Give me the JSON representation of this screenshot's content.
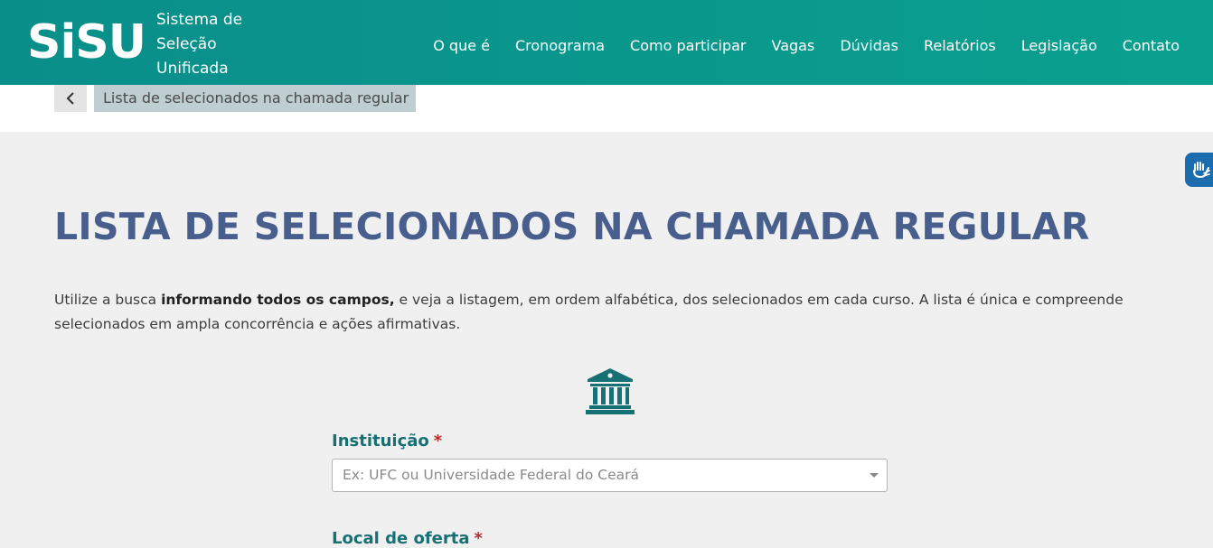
{
  "header": {
    "logo": "SiSU",
    "logo_sub": [
      "Sistema de",
      "Seleção",
      "Unificada"
    ],
    "nav": [
      "O que é",
      "Cronograma",
      "Como participar",
      "Vagas",
      "Dúvidas",
      "Relatórios",
      "Legislação",
      "Contato"
    ]
  },
  "breadcrumb": {
    "current": "Lista de selecionados na chamada regular"
  },
  "main": {
    "title": "LISTA DE SELECIONADOS NA CHAMADA REGULAR",
    "intro_before": "Utilize a busca ",
    "intro_bold": "informando todos os campos,",
    "intro_after": " e veja a listagem, em ordem alfabética, dos selecionados em cada curso. A lista é única e compreende selecionados em ampla concorrência e ações afirmativas.",
    "instituicao_label": "Instituição",
    "instituicao_placeholder": "Ex: UFC ou Universidade Federal do Ceará",
    "local_label": "Local de oferta",
    "required_mark": "*"
  },
  "icons": {
    "back": "chevron-left-icon",
    "institution": "bank-building-icon",
    "accessibility": "sign-language-icon"
  },
  "colors": {
    "header": "#0a8e8a",
    "title": "#485f8e",
    "label": "#177073",
    "required": "#b32d2d",
    "accessibility": "#1b6cae"
  }
}
